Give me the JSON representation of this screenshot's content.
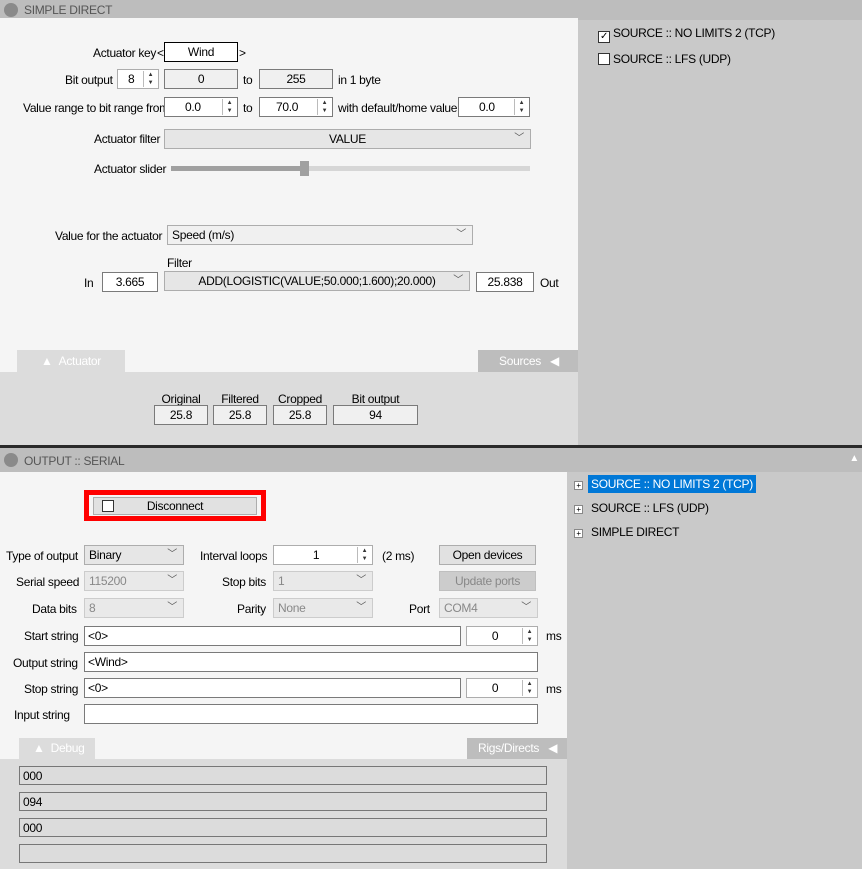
{
  "top": {
    "title": "SIMPLE DIRECT",
    "actuator_key_label": "Actuator key",
    "key_prev": "<",
    "key_next": ">",
    "key_value": "Wind",
    "bit_output_label": "Bit output",
    "bits": "8",
    "range_min": "0",
    "to": "to",
    "range_max": "255",
    "in_bytes": "in 1 byte",
    "value_range_label": "Value range to bit range from",
    "from_value": "0.0",
    "to_value": "70.0",
    "default_label": "with default/home value",
    "default_value": "0.0",
    "filter_label": "Actuator filter",
    "filter_value": "VALUE",
    "slider_label": "Actuator slider",
    "slider_fraction": 0.37,
    "value_for_label": "Value for the actuator",
    "value_for": "Speed (m/s)",
    "filter_caption": "Filter",
    "in_label": "In",
    "in_value": "3.665",
    "filter_expr": "ADD(LOGISTIC(VALUE;50.000;1.600);20.000)",
    "out_value": "25.838",
    "out_label": "Out",
    "tab_actuator": "Actuator",
    "tab_sources": "Sources",
    "readouts": [
      {
        "label": "Original",
        "value": "25.8"
      },
      {
        "label": "Filtered",
        "value": "25.8"
      },
      {
        "label": "Cropped",
        "value": "25.8"
      },
      {
        "label": "Bit output",
        "value": "94"
      }
    ]
  },
  "sources": [
    {
      "label": "SOURCE :: NO LIMITS 2 (TCP)",
      "checked": true
    },
    {
      "label": "SOURCE :: LFS (UDP)",
      "checked": false
    }
  ],
  "bottom": {
    "title": "OUTPUT :: SERIAL",
    "disconnect": "Disconnect",
    "type_label": "Type of output",
    "type_value": "Binary",
    "interval_label": "Interval loops",
    "interval_value": "1",
    "interval_ms": "(2 ms)",
    "open_devices": "Open devices",
    "speed_label": "Serial speed",
    "speed_value": "115200",
    "stop_bits_label": "Stop bits",
    "stop_bits_value": "1",
    "update_ports": "Update ports",
    "data_bits_label": "Data bits",
    "data_bits_value": "8",
    "parity_label": "Parity",
    "parity_value": "None",
    "port_label": "Port",
    "port_value": "COM4",
    "start_label": "Start string",
    "start_value": "<0>",
    "start_ms": "0",
    "ms": "ms",
    "output_label": "Output string",
    "output_value": "<Wind>",
    "stop_label": "Stop string",
    "stop_value": "<0>",
    "stop_ms": "0",
    "input_label": "Input string",
    "input_value": "",
    "tab_debug": "Debug",
    "tab_rigs": "Rigs/Directs",
    "debug_lines": [
      "000",
      "094",
      "000",
      ""
    ]
  },
  "tree": [
    "SOURCE :: NO LIMITS 2 (TCP)",
    "SOURCE :: LFS (UDP)",
    "SIMPLE DIRECT"
  ]
}
